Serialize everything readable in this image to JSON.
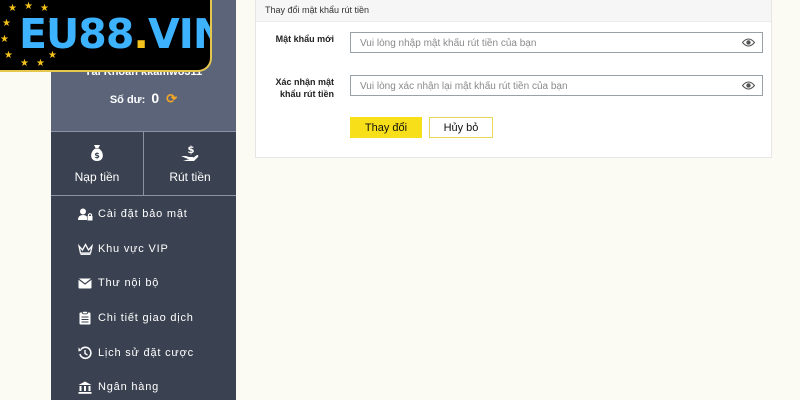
{
  "logo": {
    "part1": "EU88",
    "part2": ".",
    "part3": "VIN"
  },
  "account": {
    "label_text": "Tài Khoản kkamwo311",
    "balance_label": "Số dư:",
    "balance_value": "0"
  },
  "actions": {
    "deposit": "Nạp tiền",
    "withdraw": "Rút tiền"
  },
  "menu": [
    {
      "label": "Cài đặt bảo mật",
      "icon": "user-lock-icon"
    },
    {
      "label": "Khu vực VIP",
      "icon": "crown-icon"
    },
    {
      "label": "Thư nội bộ",
      "icon": "envelope-icon"
    },
    {
      "label": "Chi tiết giao dịch",
      "icon": "clipboard-icon"
    },
    {
      "label": "Lịch sử đặt cược",
      "icon": "history-icon"
    },
    {
      "label": "Ngân hàng",
      "icon": "bank-icon"
    }
  ],
  "form": {
    "title": "Thay đổi mật khẩu rút tiền",
    "new_password_label": "Mật khẩu mới",
    "new_password_placeholder": "Vui lòng nhập mật khẩu rút tiền của bạn",
    "confirm_label_line1": "Xác nhận mật",
    "confirm_label_line2": "khẩu rút tiền",
    "confirm_placeholder": "Vui lòng xác nhận lại mật khẩu rút tiền của bạn",
    "save_button": "Thay đổi",
    "cancel_button": "Hủy bỏ"
  },
  "colors": {
    "accent": "#f7e01a",
    "sidebar": "#3a4150",
    "sidebar_top": "#5b6479",
    "refresh": "#f5a623",
    "logo_blue": "#3db2ff",
    "logo_gold": "#f4c21b"
  }
}
